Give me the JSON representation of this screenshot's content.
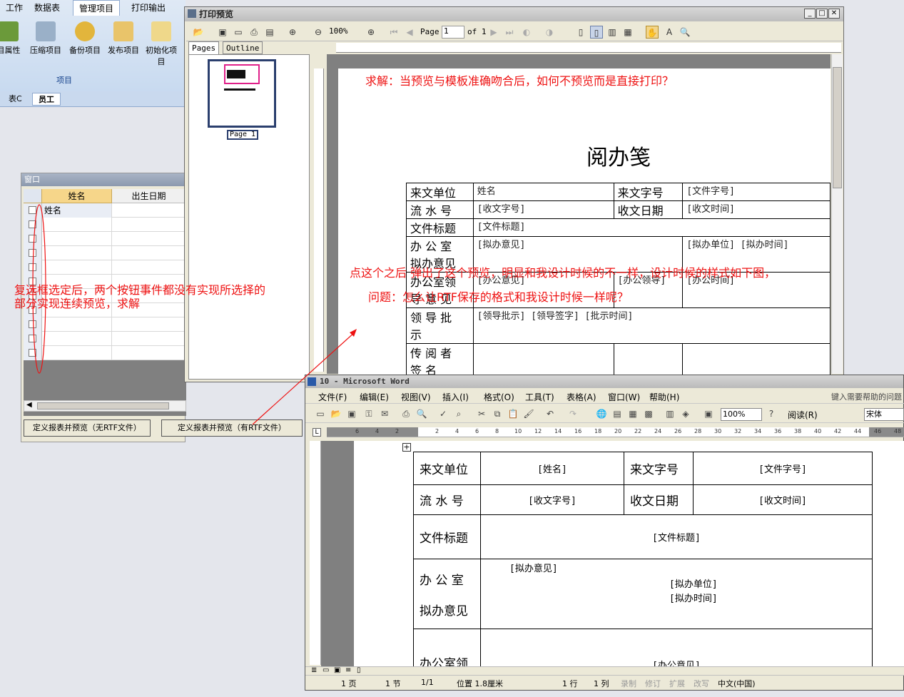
{
  "background_app": {
    "tabs": [
      "工作",
      "数据表",
      "管理项目",
      "打印输出"
    ],
    "ribbon_buttons": [
      "目属性",
      "压缩项目",
      "备份项目",
      "发布项目",
      "初始化项目"
    ],
    "group_label": "项目",
    "doc_tabs": [
      "表C",
      "员工"
    ]
  },
  "grid_window": {
    "title": "窗口",
    "columns": [
      "姓名",
      "出生日期"
    ],
    "first_row": "姓名",
    "buttons": [
      "定义报表并预览（无RTF文件）",
      "定义报表并预览（有RTF文件）"
    ]
  },
  "preview": {
    "title": "打印预览",
    "zoom": "100%",
    "page_label": "Page",
    "page_value": "1",
    "page_of": "of 1",
    "tabs": [
      "Pages",
      "Outline"
    ],
    "thumb_label": "Page 1",
    "doc_title": "阅办笺",
    "table": {
      "r1": [
        "来文单位",
        "姓名",
        "来文字号",
        "[文件字号]"
      ],
      "r2": [
        "流 水 号",
        "[收文字号]",
        "收文日期",
        "[收文时间]"
      ],
      "r3": [
        "文件标题",
        "[文件标题]"
      ],
      "r4": [
        "办 公 室",
        "拟办意见",
        "[拟办意见]",
        "[拟办单位] [拟办时间]"
      ],
      "r5": [
        "办公室领",
        "导 意 见",
        "[办公意见]",
        "[办公领导]",
        "[办公时间]"
      ],
      "r6": [
        "领 导 批",
        "示",
        "[领导批示]  [领导签字] [批示时间]"
      ],
      "r7": [
        "传 阅 者",
        "签   名"
      ]
    }
  },
  "word": {
    "title": "10 - Microsoft Word",
    "menu": [
      "文件(F)",
      "编辑(E)",
      "视图(V)",
      "插入(I)",
      "格式(O)",
      "工具(T)",
      "表格(A)",
      "窗口(W)",
      "帮助(H)"
    ],
    "help_box": "键入需要帮助的问题",
    "zoom": "100%",
    "read_btn": "阅读(R)",
    "font": "宋体",
    "ruler_numbers": [
      "6",
      "4",
      "2",
      "2",
      "4",
      "6",
      "8",
      "10",
      "12",
      "14",
      "16",
      "18",
      "20",
      "22",
      "24",
      "26",
      "28",
      "30",
      "32",
      "34",
      "36",
      "38",
      "40",
      "42",
      "44",
      "46",
      "48"
    ],
    "table": {
      "r1": [
        "来文单位",
        "[姓名]",
        "来文字号",
        "[文件字号]"
      ],
      "r2": [
        "流 水 号",
        "[收文字号]",
        "收文日期",
        "[收文时间]"
      ],
      "r3": [
        "文件标题",
        "[文件标题]"
      ],
      "r4": [
        "办 公 室",
        "拟办意见",
        "[拟办意见]",
        "[拟办单位]",
        "[拟办时间]"
      ],
      "r5": [
        "办公室领",
        "[办公意见]"
      ]
    },
    "status": [
      "1 页",
      "1 节",
      "1/1",
      "位置 1.8厘米",
      "1 行",
      "1 列",
      "录制",
      "修订",
      "扩展",
      "改写",
      "中文(中国)"
    ]
  },
  "annotations": {
    "q1": "求解：当预览与模板准确吻合后，如何不预览而是直接打印？",
    "q2a": "点这个之后 弹出了这个预览，明显和我设计时候的不一样，设计时候的样式如下图，",
    "q2b": "问题：怎么让RTF保存的格式和我设计时候一样呢？",
    "q3a": "复选框选定后，两个按钮事件都没有实现所选择的",
    "q3b": "部分实现连续预览，求解"
  },
  "colors": {
    "annotation": "#e11111",
    "ribbon": "#c8daf0",
    "grid_header": "#f6d68a"
  }
}
